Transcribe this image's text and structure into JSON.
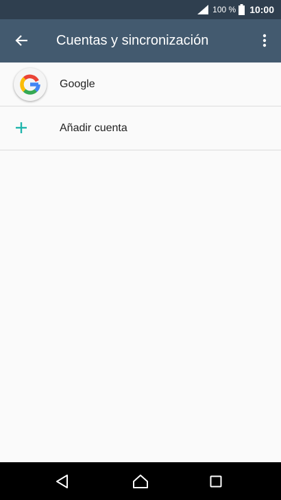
{
  "status_bar": {
    "battery_percent": "100 %",
    "time": "10:00",
    "icons": [
      "signal-icon",
      "battery-icon"
    ]
  },
  "app_bar": {
    "title": "Cuentas y sincronización",
    "icons": [
      "back-arrow-icon",
      "more-vert-icon"
    ]
  },
  "accounts": [
    {
      "label": "Google",
      "icon": "google-logo-icon"
    },
    {
      "label": "Añadir cuenta",
      "icon": "plus-icon"
    }
  ],
  "nav_bar": {
    "icons": [
      "back-triangle-icon",
      "home-icon",
      "recents-square-icon"
    ]
  },
  "colors": {
    "status_bar": "#2f3f4f",
    "app_bar": "#435a6f",
    "background": "#fafafa",
    "accent": "#1fb5ac",
    "nav_bar": "#000000"
  }
}
